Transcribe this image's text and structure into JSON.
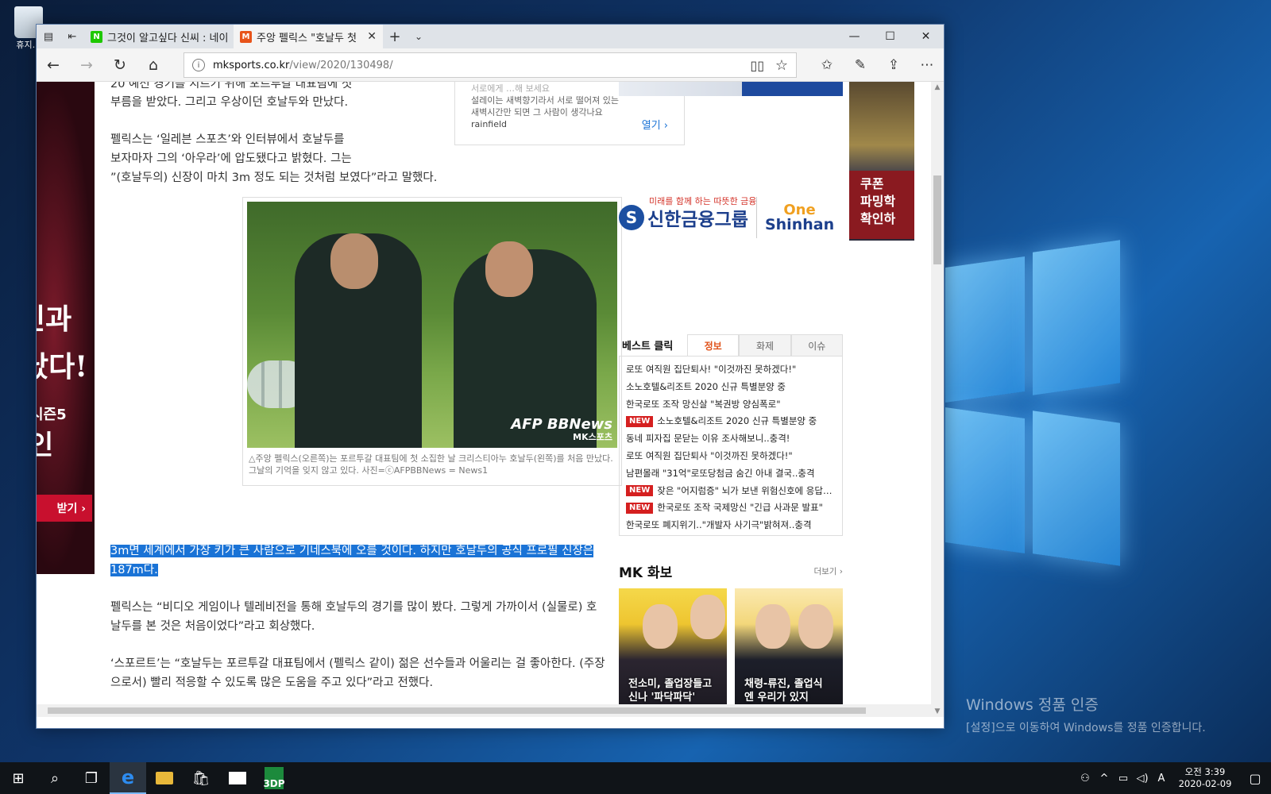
{
  "desktop": {
    "recycle_label": "휴지…",
    "activation_title": "Windows 정품 인증",
    "activation_subtitle": "[설정]으로 이동하여 Windows를 정품 인증합니다."
  },
  "browser": {
    "tabs": [
      {
        "label": "그것이 알고싶다 신씨 : 네이",
        "favicon": "N",
        "favicon_color": "#1ec800",
        "active": false
      },
      {
        "label": "주앙 펠릭스 \"호날두 첫",
        "favicon": "M",
        "favicon_color": "#e8541a",
        "active": true
      }
    ],
    "new_tab": "+",
    "window_controls": {
      "minimize": "—",
      "maximize": "☐",
      "close": "✕"
    },
    "address": {
      "host": "mksports.co.kr",
      "path": "/view/2020/130498/"
    }
  },
  "article": {
    "p0": "20 예선 경기를 치르기 위해 포르투갈 대표팀에 첫",
    "p1": "부름을 받았다. 그리고 우상이던 호날두와 만났다.",
    "p2_l1": "펠릭스는 ‘일레븐 스포츠’와 인터뷰에서 호날두를",
    "p2_l2": "보자마자 그의 ‘아우라’에 압도됐다고 밝혔다. 그는",
    "p2_l3": "”(호날두의) 신장이 마치 3m 정도 되는 것처럼 보였다”라고 말했다.",
    "photo_watermark": "AFP BBNews",
    "photo_watermark2": "MK스포츠",
    "caption": "△주앙 펠릭스(오른쪽)는 포르투갈 대표팀에 첫 소집한 날 크리스티아누 호날두(왼쪽)를 처음 만났다. 그날의 기억을 잊지 않고 있다. 사진=ⓒAFPBBNews = News1",
    "highlighted": "3m면 세계에서 가장 키가 큰 사람으로 기네스북에 오를 것이다. 하지만 호날두의 공식 프로필 신장은 187m다.",
    "p4": "펠릭스는 “비디오 게임이나 텔레비전을 통해 호날두의 경기를 많이 봤다. 그렇게 가까이서 (실물로) 호날두를 본 것은 처음이었다”라고 회상했다.",
    "p5": "‘스포르트’는 “호날두는 포르투갈 대표팀에서 (펠릭스 같이) 젊은 선수들과 어울리는 걸 좋아한다. (주장으로서) 빨리 적응할 수 있도록 많은 도움을 주고 있다”라고 전했다.",
    "infobox_top": "서로에게 …해 보세요",
    "infobox_l1": "설레이는 새벽향기라서 서로 떨어져 있는",
    "infobox_l2": "새벽시간만 되면 그 사람이 생각나요",
    "infobox_src": "rainfield",
    "infobox_open": "열기 ›"
  },
  "ads": {
    "left_l1": "인과",
    "left_l2": "났다!",
    "left_l3": "시즌5",
    "left_l4": "인",
    "left_btn": "받기 ›",
    "shinhan_slogan": "미래를 함께 하는 따뜻한 금융",
    "shinhan_name": "신한금융그룹",
    "shinhan_one": "One",
    "shinhan_brand": "Shinhan",
    "side_l1": "쿠폰",
    "side_l2": "파밍학",
    "side_l3": "확인하"
  },
  "best": {
    "title": "베스트 클릭",
    "tabs": [
      "정보",
      "화제",
      "이슈"
    ],
    "new_label": "NEW",
    "items": [
      {
        "text": "로또 여직원 집단퇴사! \"이것까진 못하겠다!\"",
        "new": false
      },
      {
        "text": "소노호텔&리조트 2020 신규 특별분양 중",
        "new": false
      },
      {
        "text": "한국로또 조작 망신살 \"복권방 양심폭로\"",
        "new": false
      },
      {
        "text": "소노호텔&리조트 2020 신규 특별분양 중",
        "new": true
      },
      {
        "text": "동네 피자집 문닫는 이유 조사해보니..충격!",
        "new": false
      },
      {
        "text": "로또 여직원 집단퇴사 \"이것까진 못하겠다!\"",
        "new": false
      },
      {
        "text": "남편몰래 \"31억\"로또당첨금 숨긴 아내 결국..충격",
        "new": false
      },
      {
        "text": "잦은 \"어지럼증\" 뇌가 보낸 위험신호에 응답…",
        "new": true
      },
      {
        "text": "한국로또 조작 국제망신 \"긴급 사과문 발표\"",
        "new": true
      },
      {
        "text": "한국로또 폐지위기..\"개발자 사기극\"밝혀져..충격",
        "new": false
      }
    ]
  },
  "mk": {
    "title": "MK 화보",
    "more": "더보기 ›",
    "thumbs": [
      {
        "l1": "전소미, 졸업장들고",
        "l2": "신나 '파닥파닥'"
      },
      {
        "l1": "채령-류진, 졸업식",
        "l2": "엔 우리가 있지"
      }
    ]
  },
  "taskbar": {
    "time": "오전 3:39",
    "date": "2020-02-09",
    "lang": "A",
    "app_label": "3DP"
  }
}
